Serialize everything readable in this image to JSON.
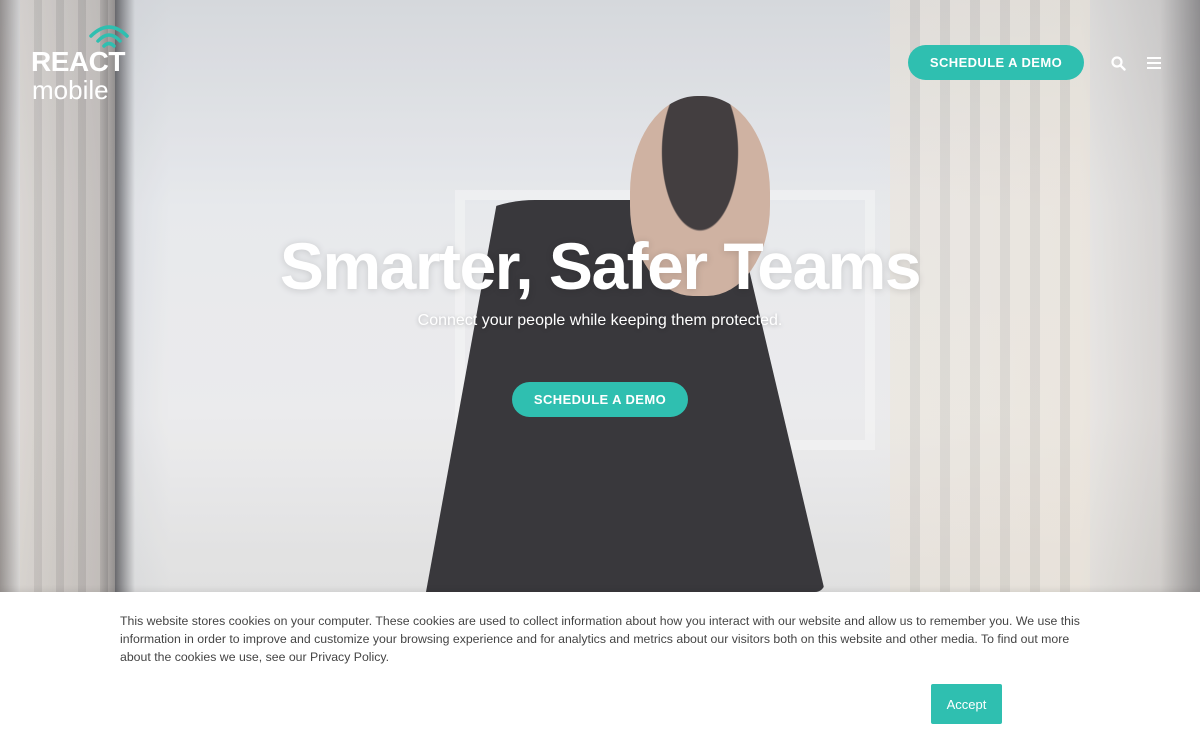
{
  "logo": {
    "line1": "REACT",
    "line2": "mobile"
  },
  "header": {
    "demo_label": "SCHEDULE A DEMO"
  },
  "icons": {
    "search": "search-icon",
    "menu": "hamburger-menu-icon",
    "logo_signal": "signal-wave-icon"
  },
  "hero": {
    "title": "Smarter, Safer Teams",
    "subtitle": "Connect your people while keeping them protected.",
    "cta_label": "SCHEDULE A DEMO"
  },
  "cookie": {
    "text": "This website stores cookies on your computer. These cookies are used to collect information about how you interact with our website and allow us to remember you. We use this information in order to improve and customize your browsing experience and for analytics and metrics about our visitors both on this website and other media. To find out more about the cookies we use, see our Privacy Policy.",
    "accept_label": "Accept"
  },
  "colors": {
    "accent": "#2fbfb0",
    "text": "#444444",
    "white": "#ffffff"
  }
}
